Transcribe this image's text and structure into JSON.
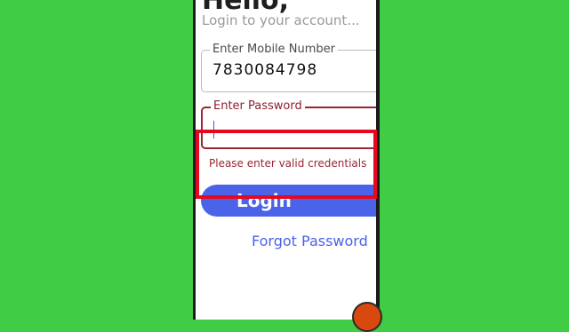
{
  "header": {
    "greeting": "Hello,",
    "subtitle": "Login to your account..."
  },
  "form": {
    "mobile_label": "Enter Mobile Number",
    "mobile_value": "7830084798",
    "password_label": "Enter Password",
    "password_value": "",
    "error_message": "Please enter valid credentials"
  },
  "actions": {
    "login_label": "Login",
    "forgot_label": "Forgot Password"
  },
  "colors": {
    "background": "#41cc45",
    "accent": "#4a63e8",
    "error": "#9a2532",
    "highlight": "#e5091f"
  }
}
